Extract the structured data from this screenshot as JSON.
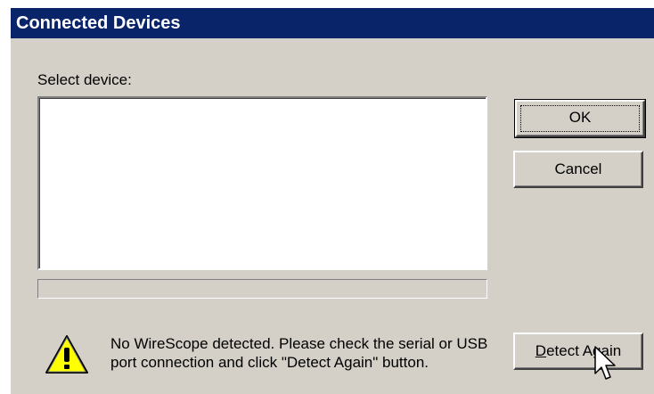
{
  "dialog": {
    "title": "Connected Devices",
    "select_label": "Select device:",
    "devices": [],
    "progress_fraction": 0,
    "message": "No WireScope detected. Please check the serial or USB port connection and click \"Detect Again\" button.",
    "buttons": {
      "ok": "OK",
      "cancel": "Cancel",
      "detect_again_mnemonic": "D",
      "detect_again_rest": "etect Again"
    }
  },
  "icons": {
    "warning": "warning-icon",
    "cursor": "arrow-cursor-icon"
  },
  "colors": {
    "titlebar": "#0a246a",
    "face": "#d4d0c8",
    "warning_yellow": "#ffff00"
  }
}
